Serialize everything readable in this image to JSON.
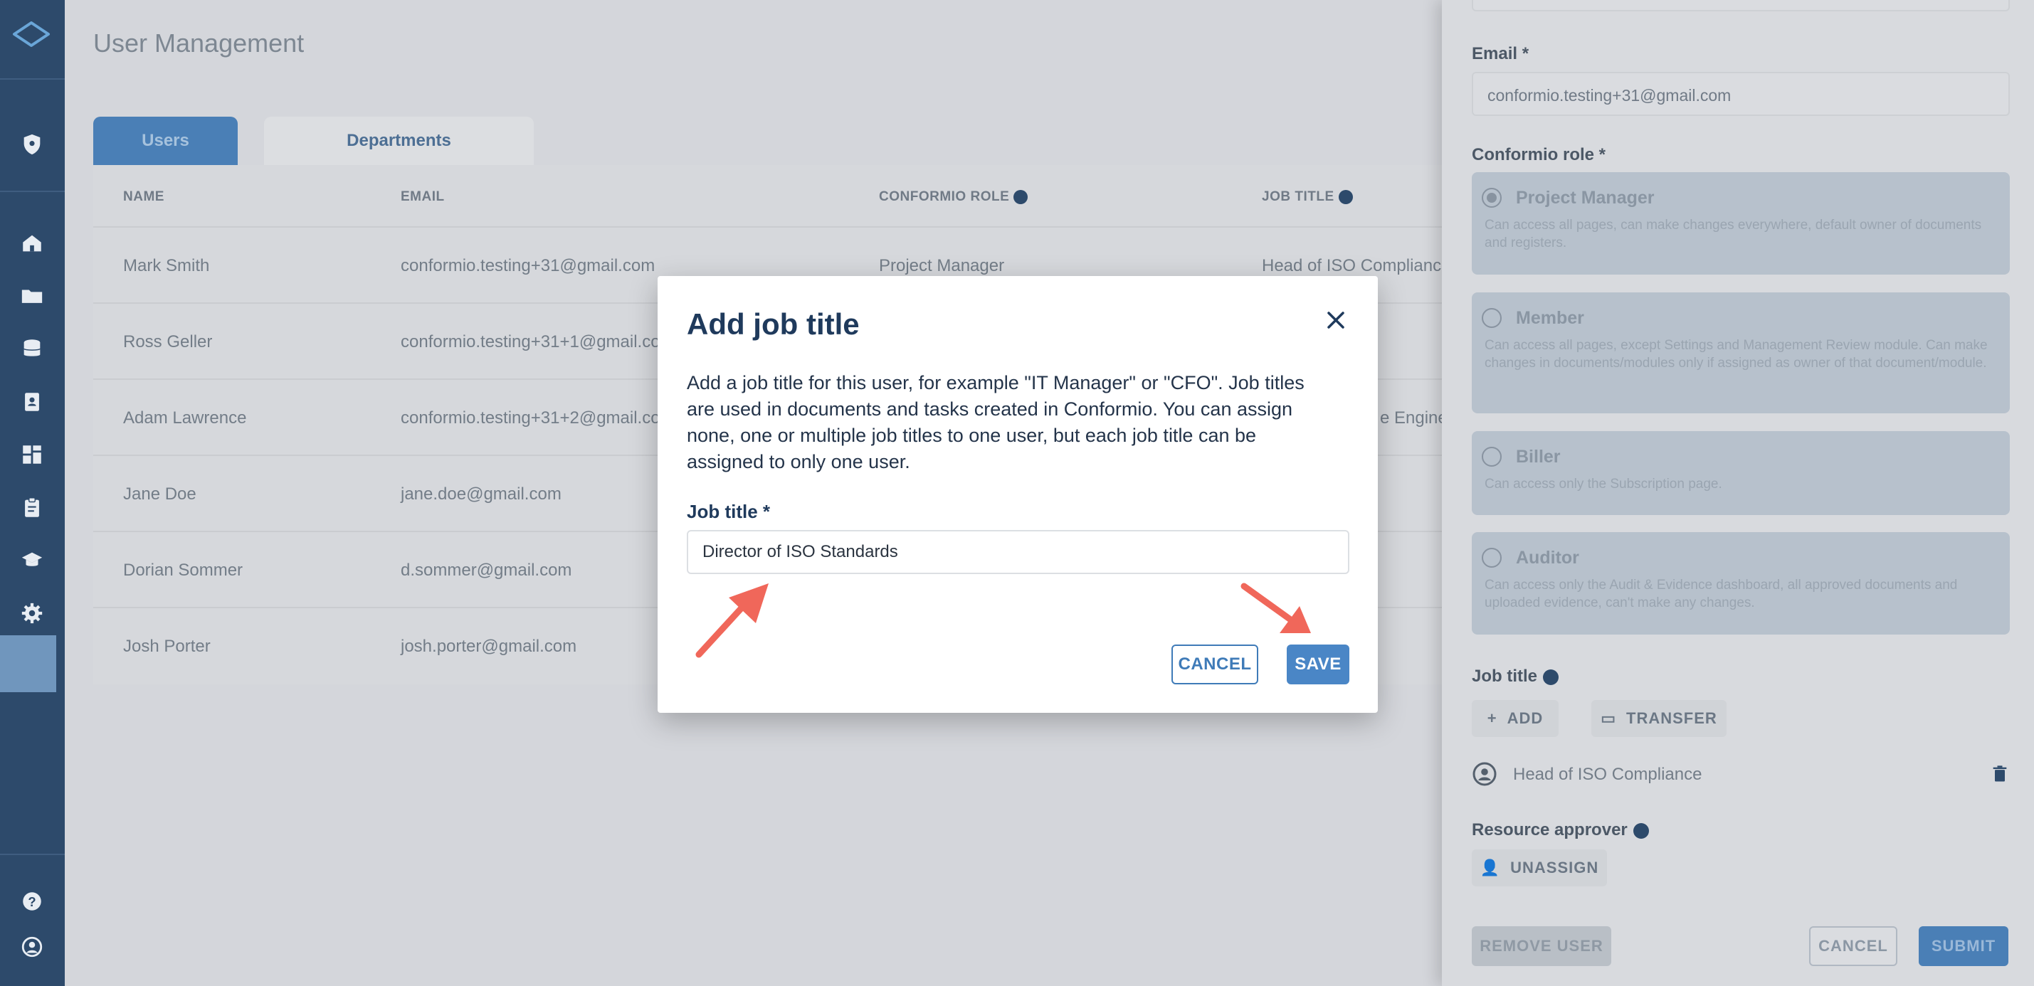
{
  "page": {
    "title": "User Management",
    "tabs": [
      "Users",
      "Departments"
    ]
  },
  "table": {
    "columns": [
      "NAME",
      "EMAIL",
      "CONFORMIO ROLE",
      "JOB TITLE"
    ],
    "rows": [
      {
        "name": "Mark Smith",
        "email": "conformio.testing+31@gmail.com",
        "role": "Project Manager",
        "job_title": "Head of ISO Complianc"
      },
      {
        "name": "Ross Geller",
        "email": "conformio.testing+31+1@gmail.co",
        "role": "",
        "job_title": ""
      },
      {
        "name": "Adam Lawrence",
        "email": "conformio.testing+31+2@gmail.co",
        "role": "",
        "job_title": "e Engine"
      },
      {
        "name": "Jane Doe",
        "email": "jane.doe@gmail.com",
        "role": "",
        "job_title": ""
      },
      {
        "name": "Dorian Sommer",
        "email": "d.sommer@gmail.com",
        "role": "",
        "job_title": ""
      },
      {
        "name": "Josh Porter",
        "email": "josh.porter@gmail.com",
        "role": "",
        "job_title": ""
      }
    ]
  },
  "drawer": {
    "email_label": "Email *",
    "email_value": "conformio.testing+31@gmail.com",
    "role_label": "Conformio role *",
    "roles": [
      {
        "name": "Project Manager",
        "desc": "Can access all pages, can make changes everywhere, default owner of documents and registers.",
        "selected": true
      },
      {
        "name": "Member",
        "desc": "Can access all pages, except Settings and Management Review module. Can make changes in documents/modules only if assigned as owner of that document/module.",
        "selected": false
      },
      {
        "name": "Biller",
        "desc": "Can access only the Subscription page.",
        "selected": false
      },
      {
        "name": "Auditor",
        "desc": "Can access only the Audit & Evidence dashboard, all approved documents and uploaded evidence, can't make any changes.",
        "selected": false
      }
    ],
    "job_title_label": "Job title",
    "add_label": "ADD",
    "transfer_label": "TRANSFER",
    "current_job_title": "Head of ISO Compliance",
    "resource_approver_label": "Resource approver",
    "unassign_label": "UNASSIGN",
    "remove_user_label": "REMOVE USER",
    "cancel_label": "CANCEL",
    "submit_label": "SUBMIT"
  },
  "modal": {
    "title": "Add job title",
    "description": "Add a job title for this user, for example \"IT Manager\" or \"CFO\". Job titles are used in documents and tasks created in Conformio. You can assign none, one or multiple job titles to one user, but each job title can be assigned to only one user.",
    "field_label": "Job title *",
    "field_value": "Director of ISO Standards",
    "cancel_label": "CANCEL",
    "save_label": "SAVE"
  },
  "colors": {
    "sidebar": "#2d4a6b",
    "primary": "#4a86c6",
    "annotation_arrow": "#f0675a"
  }
}
